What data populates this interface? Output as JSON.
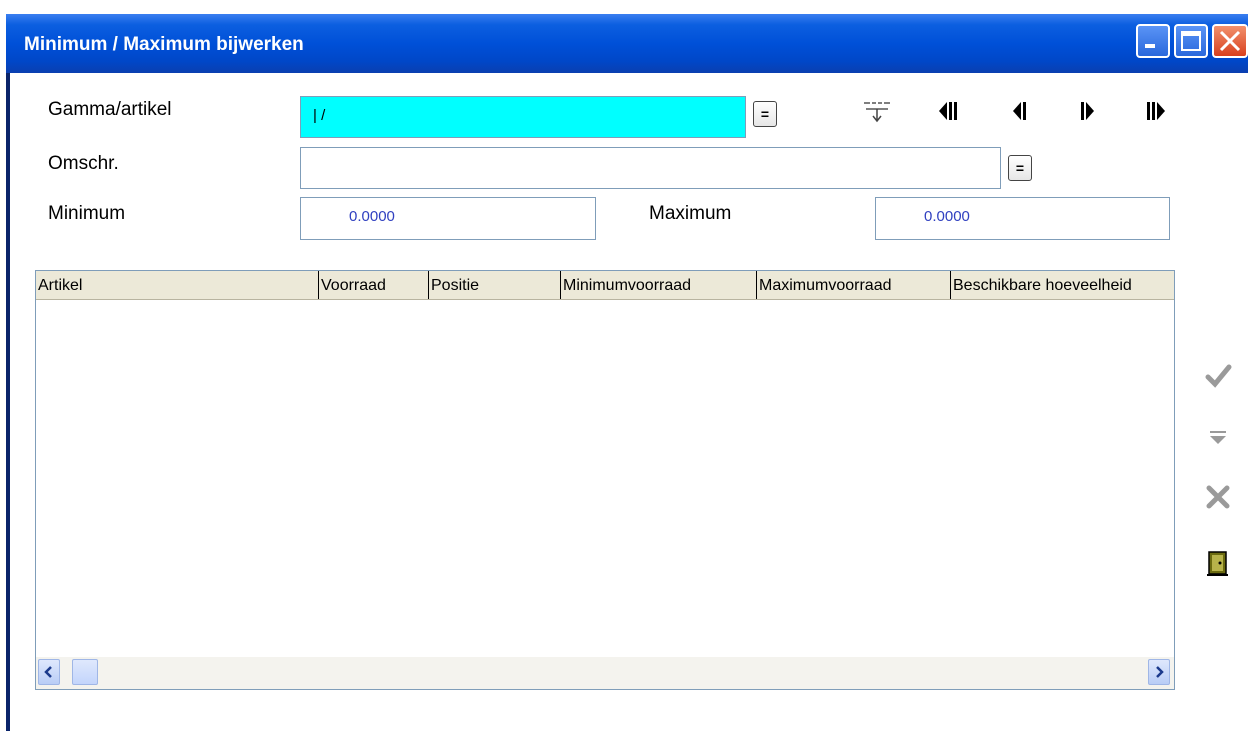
{
  "window": {
    "title": "Minimum / Maximum bijwerken"
  },
  "form": {
    "gamma_label": "Gamma/artikel",
    "gamma_value": "| /",
    "omschr_label": "Omschr.",
    "omschr_value": "",
    "minimum_label": "Minimum",
    "minimum_value": "0.0000",
    "maximum_label": "Maximum",
    "maximum_value": "0.0000",
    "lookup_label": "="
  },
  "colors": {
    "title_bar": "#0050d8",
    "active_field": "#00ffff",
    "number_text": "#3040c0"
  },
  "table": {
    "columns": [
      "Artikel",
      "Voorraad",
      "Positie",
      "Minimumvoorraad",
      "Maximumvoorraad",
      "Beschikbare hoeveelheid"
    ],
    "rows": []
  },
  "icons": {
    "navigation": [
      "filter-icon",
      "first-record-icon",
      "previous-record-icon",
      "next-record-icon",
      "last-record-icon"
    ],
    "side": [
      "confirm-check-icon",
      "filter-down-icon",
      "cancel-x-icon",
      "exit-door-icon"
    ],
    "window": [
      "minimize-icon",
      "maximize-icon",
      "close-icon"
    ]
  }
}
